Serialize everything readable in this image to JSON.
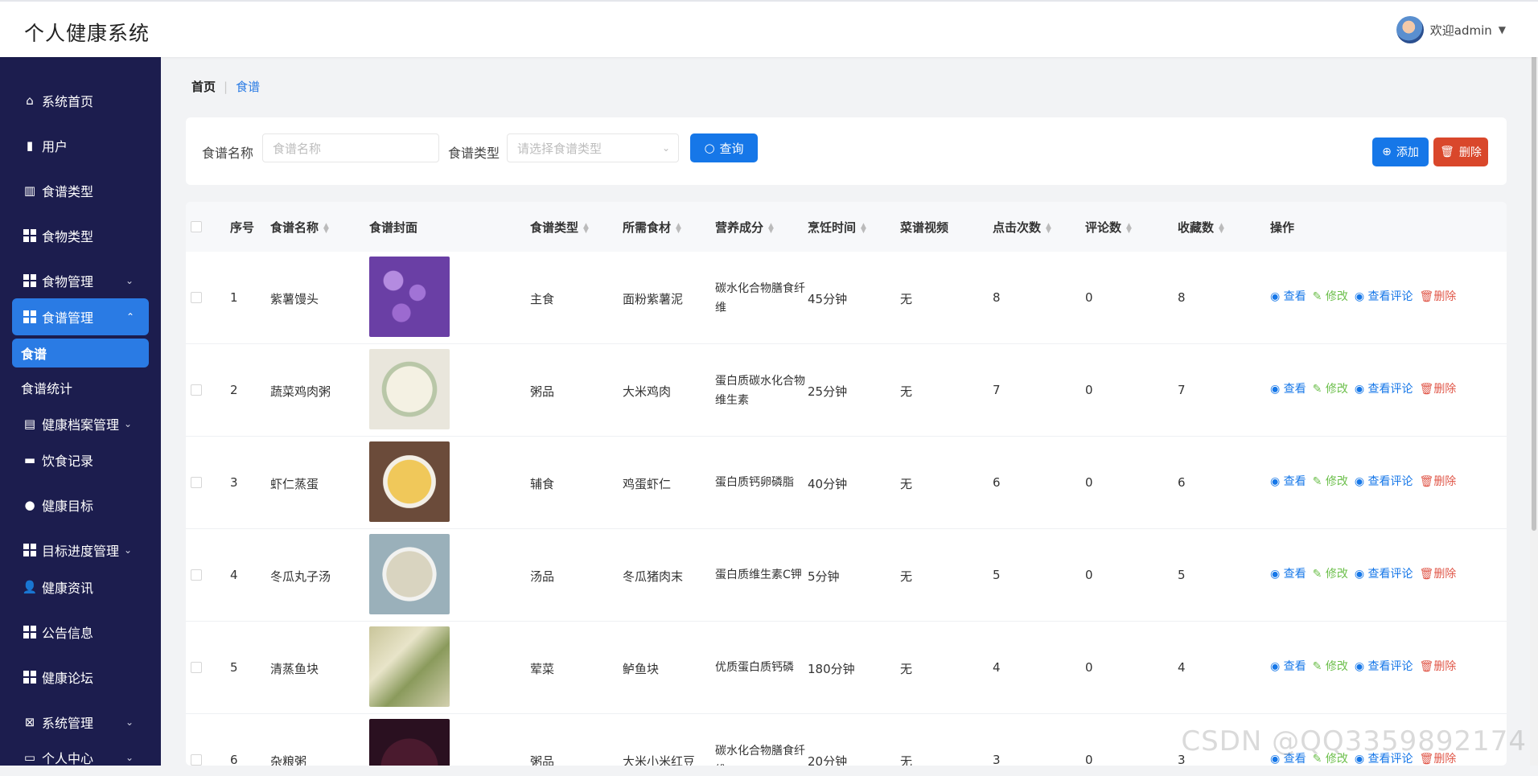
{
  "app": {
    "title": "个人健康系统",
    "welcome": "欢迎admin"
  },
  "sidebar": {
    "items": [
      {
        "label": "系统首页",
        "icon": "home-icon"
      },
      {
        "label": "用户",
        "icon": "bar-chart-icon"
      },
      {
        "label": "食谱类型",
        "icon": "books-icon"
      },
      {
        "label": "食物类型",
        "icon": "grid-icon"
      },
      {
        "label": "食物管理",
        "icon": "grid-icon"
      },
      {
        "label": "食谱管理",
        "icon": "grid-icon"
      },
      {
        "label": "健康档案管理",
        "icon": "clipboard-icon"
      },
      {
        "label": "饮食记录",
        "icon": "briefcase-icon"
      },
      {
        "label": "健康目标",
        "icon": "bulb-icon"
      },
      {
        "label": "目标进度管理",
        "icon": "grid-icon"
      },
      {
        "label": "健康资讯",
        "icon": "user-icon"
      },
      {
        "label": "公告信息",
        "icon": "grid-icon"
      },
      {
        "label": "健康论坛",
        "icon": "grid-icon"
      },
      {
        "label": "系统管理",
        "icon": "clipboard-x-icon"
      },
      {
        "label": "个人中心",
        "icon": "window-icon"
      }
    ],
    "sub": {
      "recipes": "食谱",
      "stats": "食谱统计"
    }
  },
  "breadcrumb": {
    "home": "首页",
    "current": "食谱"
  },
  "search": {
    "name_label": "食谱名称",
    "name_placeholder": "食谱名称",
    "type_label": "食谱类型",
    "type_placeholder": "请选择食谱类型",
    "query_label": "查询",
    "add_label": "添加",
    "delete_label": "删除"
  },
  "table": {
    "headers": [
      "序号",
      "食谱名称",
      "食谱封面",
      "食谱类型",
      "所需食材",
      "营养成分",
      "烹饪时间",
      "菜谱视频",
      "点击次数",
      "评论数",
      "收藏数",
      "操作"
    ],
    "ops": {
      "view": "查看",
      "edit": "修改",
      "comments": "查看评论",
      "delete": "删除"
    },
    "rows": [
      {
        "idx": "1",
        "name": "紫薯馒头",
        "type": "主食",
        "ingredients": "面粉紫薯泥",
        "nutrition": "碳水化合物膳食纤维",
        "time": "45分钟",
        "video": "无",
        "clicks": "8",
        "comments": "0",
        "favorites": "8"
      },
      {
        "idx": "2",
        "name": "蔬菜鸡肉粥",
        "type": "粥品",
        "ingredients": "大米鸡肉",
        "nutrition": "蛋白质碳水化合物维生素",
        "time": "25分钟",
        "video": "无",
        "clicks": "7",
        "comments": "0",
        "favorites": "7"
      },
      {
        "idx": "3",
        "name": "虾仁蒸蛋",
        "type": "辅食",
        "ingredients": "鸡蛋虾仁",
        "nutrition": "蛋白质钙卵磷脂",
        "time": "40分钟",
        "video": "无",
        "clicks": "6",
        "comments": "0",
        "favorites": "6"
      },
      {
        "idx": "4",
        "name": "冬瓜丸子汤",
        "type": "汤品",
        "ingredients": "冬瓜猪肉末",
        "nutrition": "蛋白质维生素C钾",
        "time": "5分钟",
        "video": "无",
        "clicks": "5",
        "comments": "0",
        "favorites": "5"
      },
      {
        "idx": "5",
        "name": "清蒸鱼块",
        "type": "荤菜",
        "ingredients": "鲈鱼块",
        "nutrition": "优质蛋白质钙磷",
        "time": "180分钟",
        "video": "无",
        "clicks": "4",
        "comments": "0",
        "favorites": "4"
      },
      {
        "idx": "6",
        "name": "杂粮粥",
        "type": "粥品",
        "ingredients": "大米小米红豆",
        "nutrition": "碳水化合物膳食纤维",
        "time": "20分钟",
        "video": "无",
        "clicks": "3",
        "comments": "0",
        "favorites": "3"
      }
    ]
  },
  "watermark": "CSDN @QQ3359892174",
  "colors": {
    "sidebar": "#1c1d4e",
    "accent": "#2a7be4",
    "danger": "#d9472b",
    "edit": "#6cbf4b"
  }
}
